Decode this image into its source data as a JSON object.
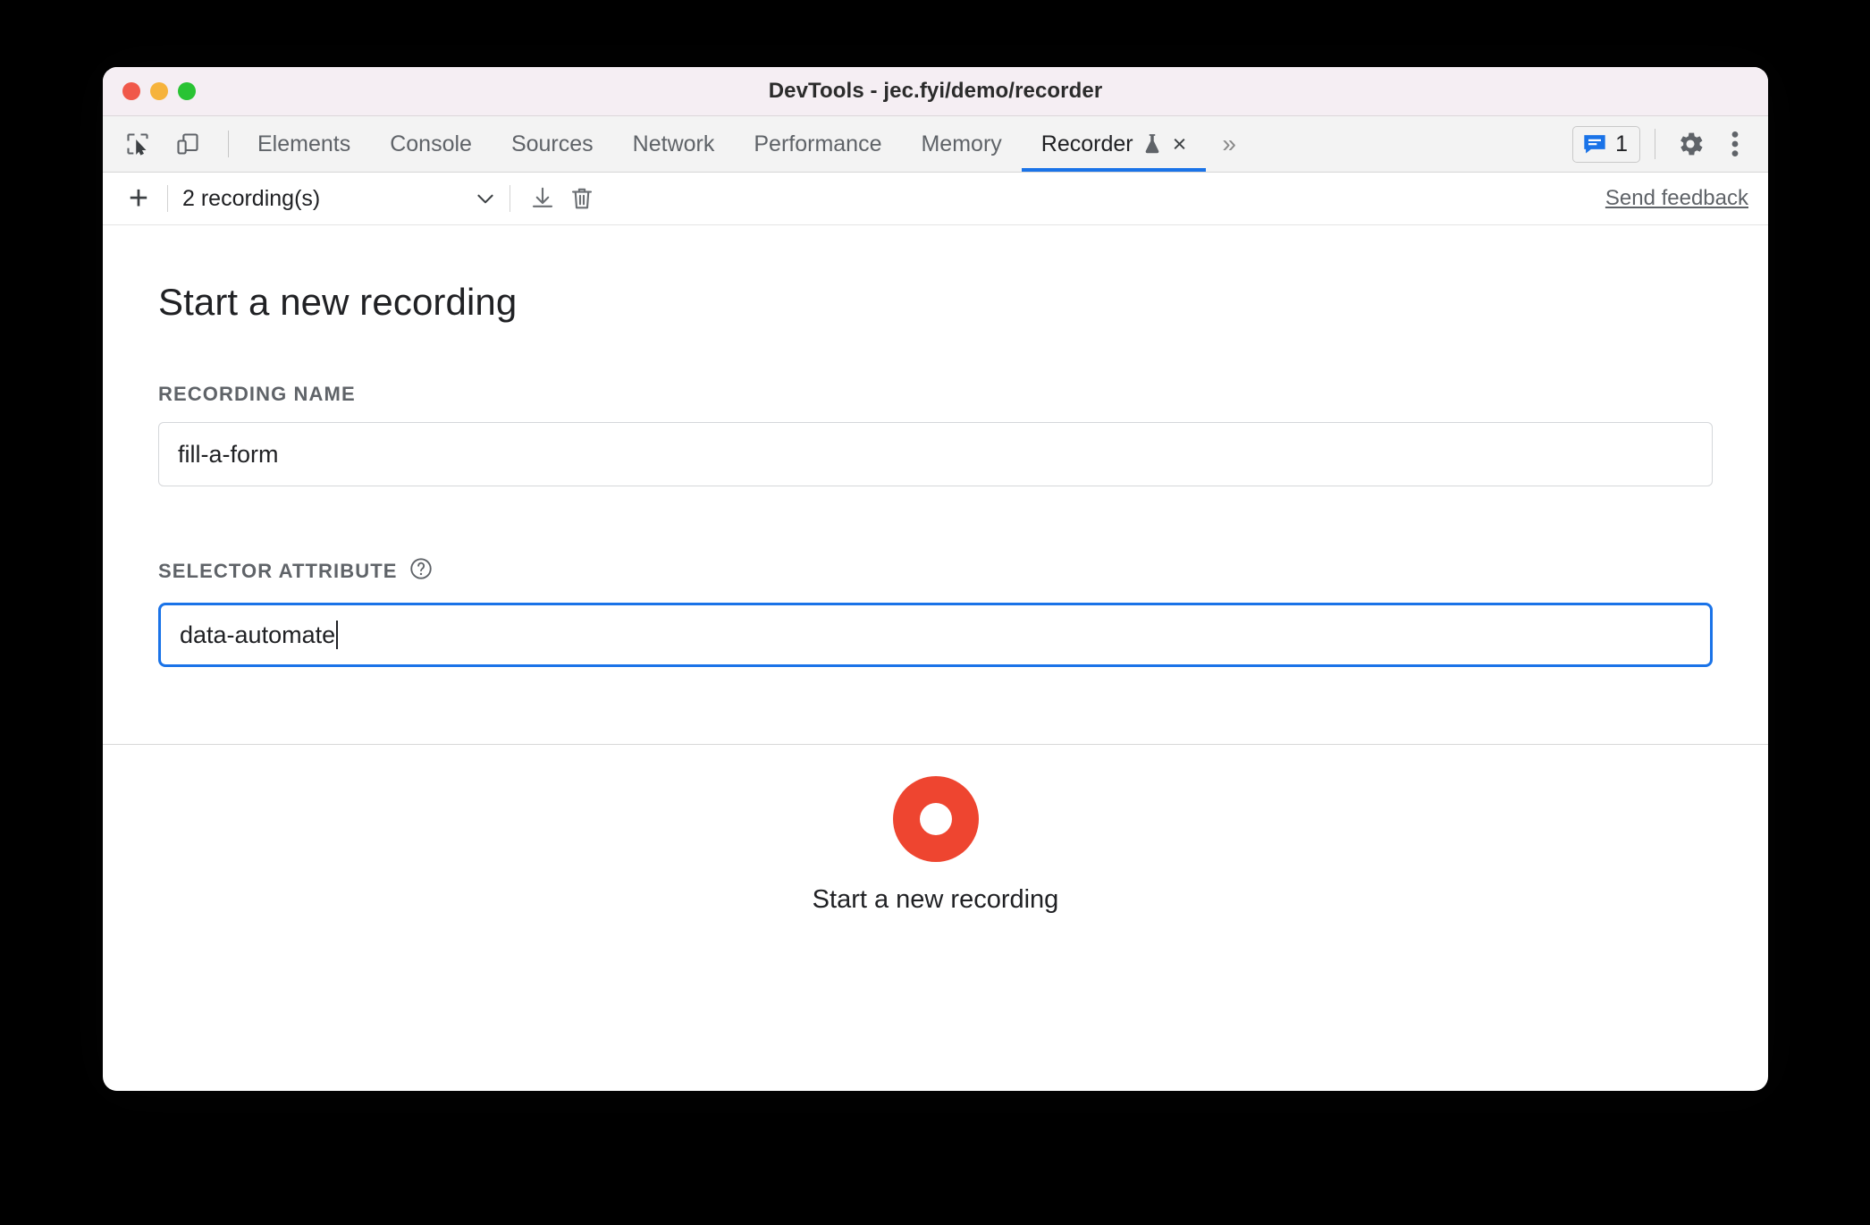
{
  "window": {
    "title": "DevTools - jec.fyi/demo/recorder",
    "traffic_lights": [
      "close",
      "minimize",
      "zoom"
    ]
  },
  "tabbar": {
    "left_icons": [
      {
        "name": "inspect-element-icon"
      },
      {
        "name": "device-toolbar-icon"
      }
    ],
    "tabs": [
      {
        "label": "Elements",
        "active": false
      },
      {
        "label": "Console",
        "active": false
      },
      {
        "label": "Sources",
        "active": false
      },
      {
        "label": "Network",
        "active": false
      },
      {
        "label": "Performance",
        "active": false
      },
      {
        "label": "Memory",
        "active": false
      },
      {
        "label": "Recorder",
        "active": true,
        "experimental": true,
        "closable": true
      }
    ],
    "close_glyph": "×",
    "overflow_glyph": "»",
    "message_count": "1",
    "accent_color": "#1a73e8"
  },
  "recorder_toolbar": {
    "add_label": "+",
    "recordings_label": "2 recording(s)",
    "chevron": "chevron-down-icon",
    "export_icon": "download-icon",
    "delete_icon": "trash-icon",
    "send_feedback": "Send feedback"
  },
  "main": {
    "heading": "Start a new recording",
    "fields": [
      {
        "label": "RECORDING NAME",
        "value": "fill-a-form",
        "focused": false,
        "help": false
      },
      {
        "label": "SELECTOR ATTRIBUTE",
        "value": "data-automate",
        "focused": true,
        "help": true,
        "help_glyph": "?"
      }
    ]
  },
  "footer": {
    "record_button_label": "start-recording-button",
    "record_color": "#ee4530",
    "label": "Start a new recording"
  }
}
